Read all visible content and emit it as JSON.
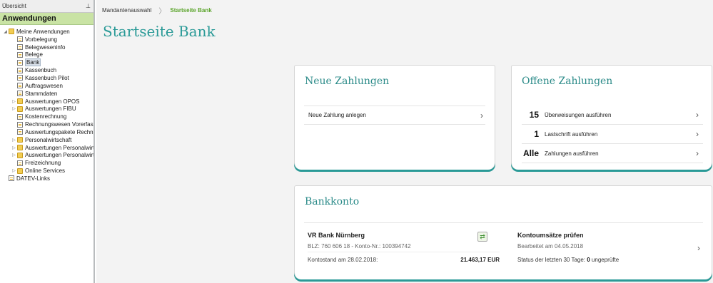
{
  "sidebar": {
    "header": "Übersicht",
    "pin_glyph": "⊥",
    "section_title": "Anwendungen",
    "tree": [
      {
        "label": "Meine Anwendungen",
        "depth": 0,
        "expander": "◢",
        "icon": "folder"
      },
      {
        "label": "Vorbelegung",
        "depth": 1,
        "expander": "",
        "icon": "doc"
      },
      {
        "label": "Belegweseninfo",
        "depth": 1,
        "expander": "",
        "icon": "doc"
      },
      {
        "label": "Belege",
        "depth": 1,
        "expander": "",
        "icon": "doc"
      },
      {
        "label": "Bank",
        "depth": 1,
        "expander": "",
        "icon": "doc",
        "selected": true
      },
      {
        "label": "Kassenbuch",
        "depth": 1,
        "expander": "",
        "icon": "doc"
      },
      {
        "label": "Kassenbuch Pilot",
        "depth": 1,
        "expander": "",
        "icon": "doc"
      },
      {
        "label": "Auftragswesen",
        "depth": 1,
        "expander": "",
        "icon": "doc"
      },
      {
        "label": "Stammdaten",
        "depth": 1,
        "expander": "",
        "icon": "doc"
      },
      {
        "label": "Auswertungen OPOS",
        "depth": 1,
        "expander": "▷",
        "icon": "folder"
      },
      {
        "label": "Auswertungen FIBU",
        "depth": 1,
        "expander": "▷",
        "icon": "folder"
      },
      {
        "label": "Kostenrechnung",
        "depth": 1,
        "expander": "",
        "icon": "doc"
      },
      {
        "label": "Rechnungswesen Vorerfass",
        "depth": 1,
        "expander": "",
        "icon": "doc"
      },
      {
        "label": "Auswertungspakete Rechnu",
        "depth": 1,
        "expander": "",
        "icon": "doc"
      },
      {
        "label": "Personalwirtschaft",
        "depth": 1,
        "expander": "▷",
        "icon": "folder"
      },
      {
        "label": "Auswertungen Personalwirt",
        "depth": 1,
        "expander": "▷",
        "icon": "folder"
      },
      {
        "label": "Auswertungen Personalwirt",
        "depth": 1,
        "expander": "▷",
        "icon": "folder"
      },
      {
        "label": "Freizeichnung",
        "depth": 1,
        "expander": "",
        "icon": "doc"
      },
      {
        "label": "Online Services",
        "depth": 1,
        "expander": "▷",
        "icon": "folder"
      },
      {
        "label": "DATEV-Links",
        "depth": 0,
        "expander": "",
        "icon": "doc"
      }
    ]
  },
  "breadcrumb": {
    "first": "Mandantenauswahl",
    "separator": "〉",
    "current": "Startseite Bank"
  },
  "page_title": "Startseite Bank",
  "neue_zahlungen": {
    "title": "Neue Zahlungen",
    "action": "Neue Zahlung anlegen",
    "chevron": "›"
  },
  "offene_zahlungen": {
    "title": "Offene Zahlungen",
    "rows": [
      {
        "count": "15",
        "label": "Überweisungen ausführen"
      },
      {
        "count": "1",
        "label": "Lastschrift ausführen"
      },
      {
        "count": "Alle",
        "label": "Zahlungen ausführen"
      }
    ],
    "chevron": "›"
  },
  "bankkonto": {
    "title": "Bankkonto",
    "bank_name": "VR Bank Nürnberg",
    "bank_details": "BLZ: 760 606 18 - Konto-Nr.: 100394742",
    "balance_label": "Kontostand am 28.02.2018:",
    "balance_value": "21.463,17 EUR",
    "sync_icon_glyph": "⇄",
    "check_title": "Kontoumsätze prüfen",
    "check_sub": "Bearbeitet am 04.05.2018",
    "status_prefix": "Status der letzten 30 Tage: ",
    "status_count": "0",
    "status_suffix": " ungeprüfte",
    "chevron": "›"
  },
  "colors": {
    "accent_teal": "#2a9a97",
    "section_green": "#c9e3a4",
    "breadcrumb_green": "#5aa42a"
  }
}
